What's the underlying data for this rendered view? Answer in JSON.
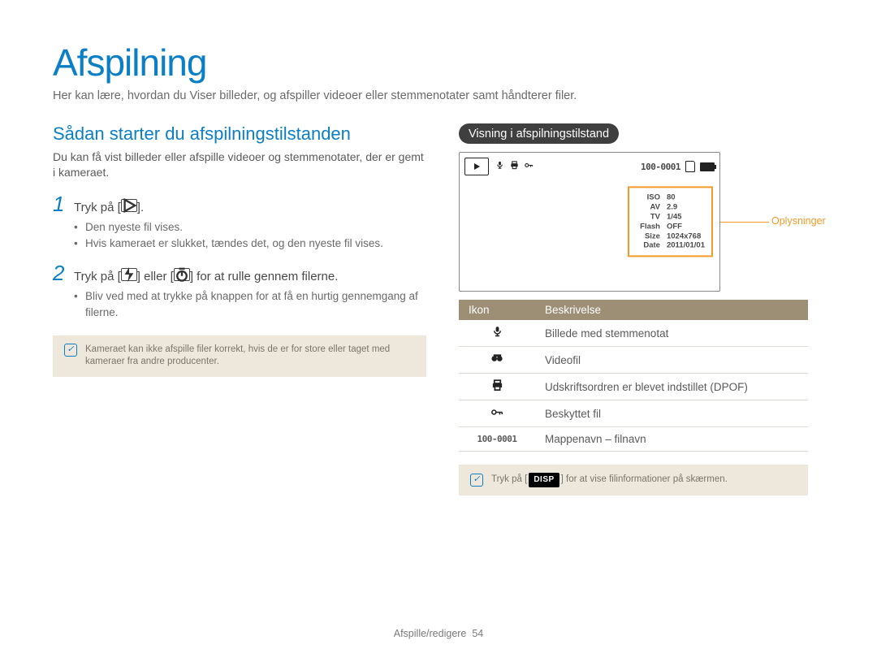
{
  "title": "Afspilning",
  "intro": "Her kan lære, hvordan du Viser billeder, og afspiller videoer eller stemmenotater samt håndterer filer.",
  "left": {
    "section_heading": "Sådan starter du afspilningstilstanden",
    "section_desc": "Du kan få vist billeder eller afspille videoer og stemmenotater, der er gemt i kameraet.",
    "step1_num": "1",
    "step1_text_pre": "Tryk på [",
    "step1_text_post": "].",
    "step1_sub1": "Den nyeste fil vises.",
    "step1_sub2": "Hvis kameraet er slukket, tændes det, og den nyeste fil vises.",
    "step2_num": "2",
    "step2_text_pre": "Tryk på [",
    "step2_text_mid": "] eller [",
    "step2_text_post": "] for at rulle gennem filerne.",
    "step2_sub1": "Bliv ved med at trykke på knappen for at få en hurtig gennemgang af filerne.",
    "note": "Kameraet kan ikke afspille filer korrekt, hvis de er for store eller taget med kameraer fra andre producenter."
  },
  "right": {
    "pill": "Visning i afspilningstilstand",
    "file_counter": "100-0001",
    "info": {
      "iso_k": "ISO",
      "iso_v": "80",
      "av_k": "AV",
      "av_v": "2.9",
      "tv_k": "TV",
      "tv_v": "1/45",
      "flash_k": "Flash",
      "flash_v": "OFF",
      "size_k": "Size",
      "size_v": "1024x768",
      "date_k": "Date",
      "date_v": "2011/01/01"
    },
    "callout": "Oplysninger",
    "table": {
      "h_icon": "Ikon",
      "h_desc": "Beskrivelse",
      "r1": "Billede med stemmenotat",
      "r2": "Videofil",
      "r3": "Udskriftsordren er blevet indstillet (DPOF)",
      "r4": "Beskyttet fil",
      "r5_icon": "100-0001",
      "r5": "Mappenavn – filnavn"
    },
    "note_pre": "Tryk på [",
    "note_btn": "DISP",
    "note_post": "] for at vise filinformationer på skærmen."
  },
  "footer": {
    "section": "Afspille/redigere",
    "page": "54"
  }
}
